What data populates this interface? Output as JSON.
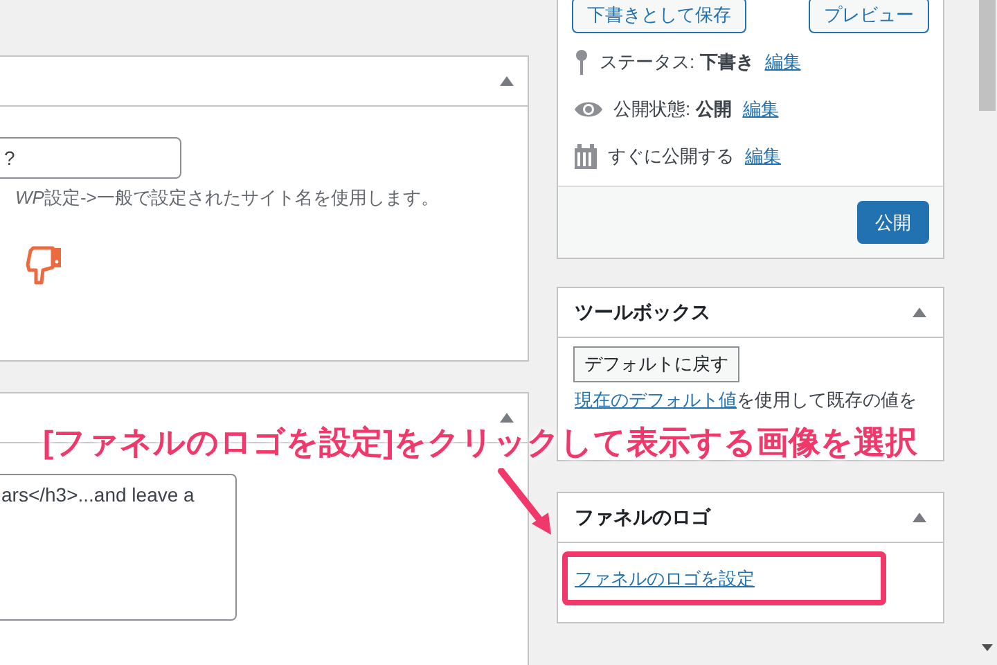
{
  "site_name_box": {
    "value": "?",
    "help_italic": "WP",
    "help": "設定->一般で設定されたサイト名を使用します。"
  },
  "excerpt_box": {
    "value": "ars</h3>...and leave a"
  },
  "publish_box": {
    "save_draft": "下書きとして保存",
    "preview": "プレビュー",
    "rows": [
      {
        "kind": "pin",
        "label": "ステータス:",
        "value": "下書き",
        "link": "編集"
      },
      {
        "kind": "eye",
        "label": "公開状態:",
        "value": "公開",
        "link": "編集"
      },
      {
        "kind": "calendar",
        "label": "すぐに公開する",
        "link": "編集"
      }
    ],
    "publish": "公開"
  },
  "toolbox": {
    "title": "ツールボックス",
    "reset_button": "デフォルトに戻す",
    "link": "現在のデフォルト値",
    "text": "を使用して既存の値を"
  },
  "funnel_logo": {
    "title": "ファネルのロゴ",
    "link": "ファネルのロゴを設定"
  },
  "annotation": {
    "text": "[ファネルのロゴを設定]をクリックして表示する画像を選択"
  }
}
